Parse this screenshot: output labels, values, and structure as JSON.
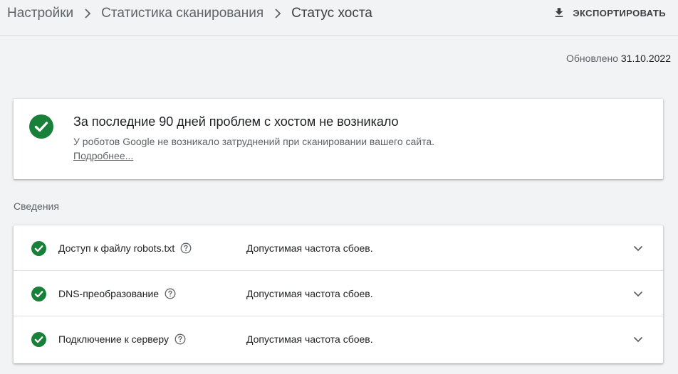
{
  "header": {
    "breadcrumbs": [
      "Настройки",
      "Статистика сканирования",
      "Статус хоста"
    ],
    "export_label": "ЭКСПОРТИРОВАТЬ"
  },
  "updated": {
    "label": "Обновлено",
    "date": "31.10.2022"
  },
  "summary": {
    "title": "За последние 90 дней проблем с хостом не возникало",
    "description": "У роботов Google не возникало затруднений при сканировании вашего сайта.",
    "more_link": "Подробнее..."
  },
  "details": {
    "section_label": "Сведения",
    "rows": [
      {
        "name": "Доступ к файлу robots.txt",
        "status": "Допустимая частота сбоев."
      },
      {
        "name": "DNS-преобразование",
        "status": "Допустимая частота сбоев."
      },
      {
        "name": "Подключение к серверу",
        "status": "Допустимая частота сбоев."
      }
    ]
  },
  "colors": {
    "success": "#188038",
    "text": "#202124",
    "muted": "#5f6368",
    "background": "#f1f3f4"
  }
}
